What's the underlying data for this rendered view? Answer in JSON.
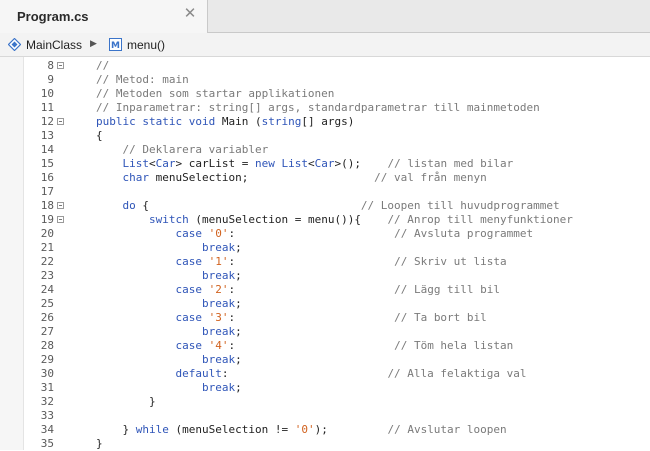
{
  "tab": {
    "title": "Program.cs",
    "close_glyph": "✕"
  },
  "breadcrumb": {
    "class_name": "MainClass",
    "separator": "▶",
    "method_name": "menu()"
  },
  "editor": {
    "lines": [
      {
        "num": "8",
        "fold": true,
        "indent": 0,
        "tokens": [
          [
            "c",
            "//"
          ]
        ]
      },
      {
        "num": "9",
        "fold": false,
        "indent": 0,
        "tokens": [
          [
            "c",
            "// Metod: main"
          ]
        ]
      },
      {
        "num": "10",
        "fold": false,
        "indent": 0,
        "tokens": [
          [
            "c",
            "// Metoden som startar applikationen"
          ]
        ]
      },
      {
        "num": "11",
        "fold": false,
        "indent": 0,
        "tokens": [
          [
            "c",
            "// Inparametrar: string[] args, standardparametrar till mainmetoden"
          ]
        ]
      },
      {
        "num": "12",
        "fold": true,
        "indent": 0,
        "tokens": [
          [
            "k",
            "public"
          ],
          [
            "p",
            " "
          ],
          [
            "k",
            "static"
          ],
          [
            "p",
            " "
          ],
          [
            "k",
            "void"
          ],
          [
            "p",
            " Main ("
          ],
          [
            "k",
            "string"
          ],
          [
            "p",
            "[] args)"
          ]
        ]
      },
      {
        "num": "13",
        "fold": false,
        "indent": 0,
        "tokens": [
          [
            "p",
            "{"
          ]
        ]
      },
      {
        "num": "14",
        "fold": false,
        "indent": 1,
        "tokens": [
          [
            "c",
            "// Deklarera variabler"
          ]
        ]
      },
      {
        "num": "15",
        "fold": false,
        "indent": 1,
        "tokens": [
          [
            "t",
            "List"
          ],
          [
            "p",
            "<"
          ],
          [
            "t",
            "Car"
          ],
          [
            "p",
            "> carList = "
          ],
          [
            "k",
            "new"
          ],
          [
            "p",
            " "
          ],
          [
            "t",
            "List"
          ],
          [
            "p",
            "<"
          ],
          [
            "t",
            "Car"
          ],
          [
            "p",
            ">();    "
          ],
          [
            "c",
            "// listan med bilar"
          ]
        ]
      },
      {
        "num": "16",
        "fold": false,
        "indent": 1,
        "tokens": [
          [
            "k",
            "char"
          ],
          [
            "p",
            " menuSelection;                   "
          ],
          [
            "c",
            "// val från menyn"
          ]
        ]
      },
      {
        "num": "17",
        "fold": false,
        "indent": 0,
        "tokens": []
      },
      {
        "num": "18",
        "fold": true,
        "indent": 1,
        "tokens": [
          [
            "k",
            "do"
          ],
          [
            "p",
            " {                                "
          ],
          [
            "c",
            "// Loopen till huvudprogrammet"
          ]
        ]
      },
      {
        "num": "19",
        "fold": true,
        "indent": 2,
        "tokens": [
          [
            "k",
            "switch"
          ],
          [
            "p",
            " (menuSelection = menu()){    "
          ],
          [
            "c",
            "// Anrop till menyfunktioner"
          ]
        ]
      },
      {
        "num": "20",
        "fold": false,
        "indent": 3,
        "tokens": [
          [
            "k",
            "case"
          ],
          [
            "p",
            " "
          ],
          [
            "s",
            "'0'"
          ],
          [
            "p",
            ":                        "
          ],
          [
            "c",
            "// Avsluta programmet"
          ]
        ]
      },
      {
        "num": "21",
        "fold": false,
        "indent": 4,
        "tokens": [
          [
            "k",
            "break"
          ],
          [
            "p",
            ";"
          ]
        ]
      },
      {
        "num": "22",
        "fold": false,
        "indent": 3,
        "tokens": [
          [
            "k",
            "case"
          ],
          [
            "p",
            " "
          ],
          [
            "s",
            "'1'"
          ],
          [
            "p",
            ":                        "
          ],
          [
            "c",
            "// Skriv ut lista"
          ]
        ]
      },
      {
        "num": "23",
        "fold": false,
        "indent": 4,
        "tokens": [
          [
            "k",
            "break"
          ],
          [
            "p",
            ";"
          ]
        ]
      },
      {
        "num": "24",
        "fold": false,
        "indent": 3,
        "tokens": [
          [
            "k",
            "case"
          ],
          [
            "p",
            " "
          ],
          [
            "s",
            "'2'"
          ],
          [
            "p",
            ":                        "
          ],
          [
            "c",
            "// Lägg till bil"
          ]
        ]
      },
      {
        "num": "25",
        "fold": false,
        "indent": 4,
        "tokens": [
          [
            "k",
            "break"
          ],
          [
            "p",
            ";"
          ]
        ]
      },
      {
        "num": "26",
        "fold": false,
        "indent": 3,
        "tokens": [
          [
            "k",
            "case"
          ],
          [
            "p",
            " "
          ],
          [
            "s",
            "'3'"
          ],
          [
            "p",
            ":                        "
          ],
          [
            "c",
            "// Ta bort bil"
          ]
        ]
      },
      {
        "num": "27",
        "fold": false,
        "indent": 4,
        "tokens": [
          [
            "k",
            "break"
          ],
          [
            "p",
            ";"
          ]
        ]
      },
      {
        "num": "28",
        "fold": false,
        "indent": 3,
        "tokens": [
          [
            "k",
            "case"
          ],
          [
            "p",
            " "
          ],
          [
            "s",
            "'4'"
          ],
          [
            "p",
            ":                        "
          ],
          [
            "c",
            "// Töm hela listan"
          ]
        ]
      },
      {
        "num": "29",
        "fold": false,
        "indent": 4,
        "tokens": [
          [
            "k",
            "break"
          ],
          [
            "p",
            ";"
          ]
        ]
      },
      {
        "num": "30",
        "fold": false,
        "indent": 3,
        "tokens": [
          [
            "k",
            "default"
          ],
          [
            "p",
            ":                        "
          ],
          [
            "c",
            "// Alla felaktiga val"
          ]
        ]
      },
      {
        "num": "31",
        "fold": false,
        "indent": 4,
        "tokens": [
          [
            "k",
            "break"
          ],
          [
            "p",
            ";"
          ]
        ]
      },
      {
        "num": "32",
        "fold": false,
        "indent": 2,
        "tokens": [
          [
            "p",
            "}"
          ]
        ]
      },
      {
        "num": "33",
        "fold": false,
        "indent": 0,
        "tokens": []
      },
      {
        "num": "34",
        "fold": false,
        "indent": 1,
        "tokens": [
          [
            "p",
            "} "
          ],
          [
            "k",
            "while"
          ],
          [
            "p",
            " (menuSelection != "
          ],
          [
            "s",
            "'0'"
          ],
          [
            "p",
            ");         "
          ],
          [
            "c",
            "// Avslutar loopen"
          ]
        ]
      },
      {
        "num": "35",
        "fold": false,
        "indent": 0,
        "tokens": [
          [
            "p",
            "}"
          ]
        ]
      }
    ]
  },
  "colors": {
    "keyword": "#2f55b8",
    "comment": "#7a7a7a",
    "string": "#d1621f",
    "plain": "#222222"
  }
}
